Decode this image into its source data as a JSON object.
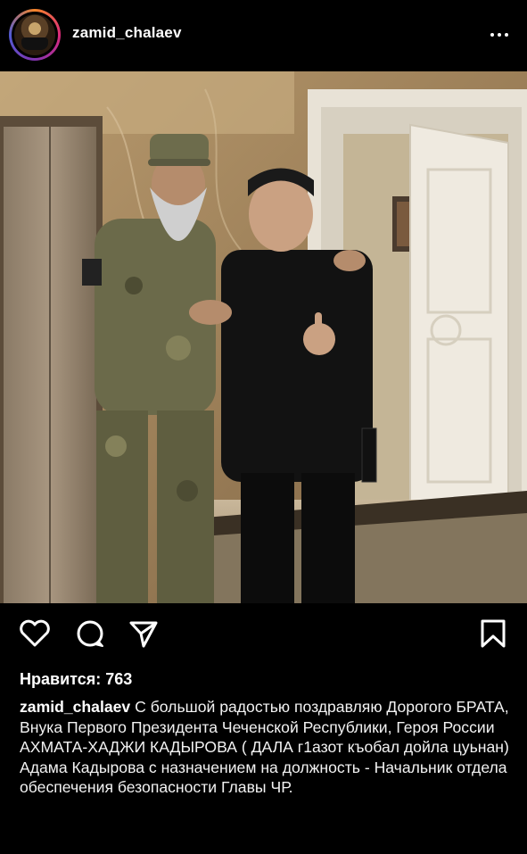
{
  "post": {
    "username": "zamid_chalaev",
    "likes_text": "Нравится: 763",
    "caption_user": "zamid_chalaev",
    "caption_text": "С большой радостью поздравляю Дорогого БРАТА, Внука Первого Президента Чеченской Республики, Героя России АХМАТА-ХАДЖИ КАДЫРОВА ( ДАЛА г1азот къобал дойла цуьнан) Адама Кадырова с назначением на должность - Начальник отдела обеспечения безопасности Главы ЧР."
  },
  "icons": {
    "more": "more-options-icon",
    "like": "heart-icon",
    "comment": "comment-icon",
    "share": "send-icon",
    "save": "bookmark-icon"
  },
  "colors": {
    "background": "#000000",
    "text": "#ffffff"
  }
}
